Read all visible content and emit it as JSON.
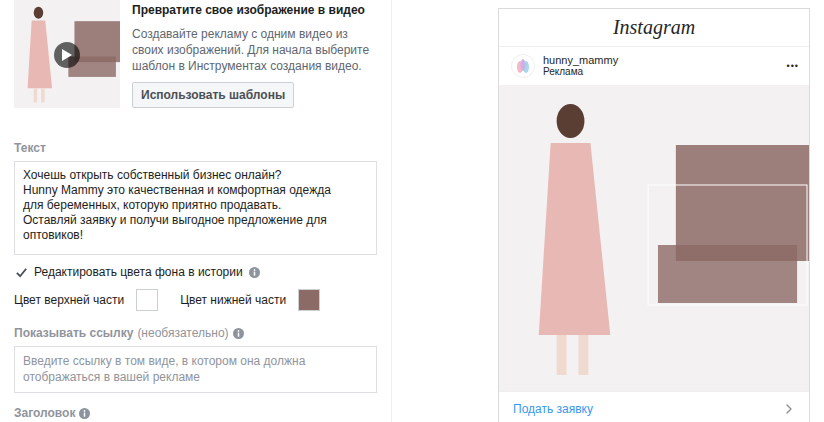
{
  "video_promo": {
    "title": "Превратите свое изображение в видео",
    "description": "Создавайте рекламу с одним видео из своих изображений. Для начала выберите шаблон в Инструментах создания видео.",
    "button": "Использовать шаблоны"
  },
  "text_field": {
    "label": "Текст",
    "value": "Хочешь открыть собственный бизнес онлайн?\nHunny Mammy это качественная и комфортная одежда\nдля беременных, которую приятно продавать.\nОставляй заявку и получи выгодное предложение для\nоптовиков!"
  },
  "story_colors": {
    "checkbox": {
      "label": "Редактировать цвета фона в истории",
      "checked": true
    },
    "swatches": [
      {
        "label": "Цвет верхней части",
        "color": "#ffffff"
      },
      {
        "label": "Цвет нижней части",
        "color": "#8c6a66"
      }
    ]
  },
  "link_field": {
    "label": "Показывать ссылку",
    "hint": "(необязательно)",
    "placeholder": "Введите ссылку в том виде, в котором она должна отображаться в вашей рекламе"
  },
  "headline_field": {
    "label": "Заголовок"
  },
  "preview": {
    "app": "Instagram",
    "account": "hunny_mammy",
    "sponsored": "Реклама",
    "menu": "•••",
    "cta": "Подать заявку"
  }
}
